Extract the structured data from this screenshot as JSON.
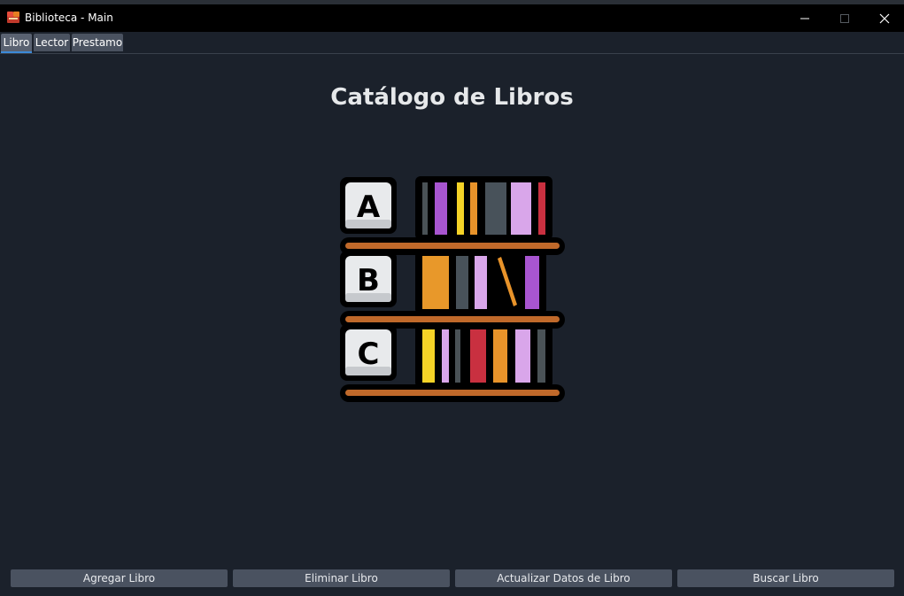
{
  "window": {
    "title": "Biblioteca - Main",
    "icon": "books-icon"
  },
  "tabs": [
    {
      "label": "Libro",
      "selected": true
    },
    {
      "label": "Lector",
      "selected": false
    },
    {
      "label": "Prestamo",
      "selected": false
    }
  ],
  "main": {
    "title": "Catálogo de Libros",
    "shelf_letters": [
      "A",
      "B",
      "C"
    ]
  },
  "actions": {
    "agregar": "Agregar Libro",
    "eliminar": "Eliminar Libro",
    "actualizar": "Actualizar Datos de Libro",
    "buscar": "Buscar Libro"
  },
  "colors": {
    "background": "#1b212b",
    "button": "#4a5260",
    "selected_tab_underline": "#3b8ad9"
  }
}
